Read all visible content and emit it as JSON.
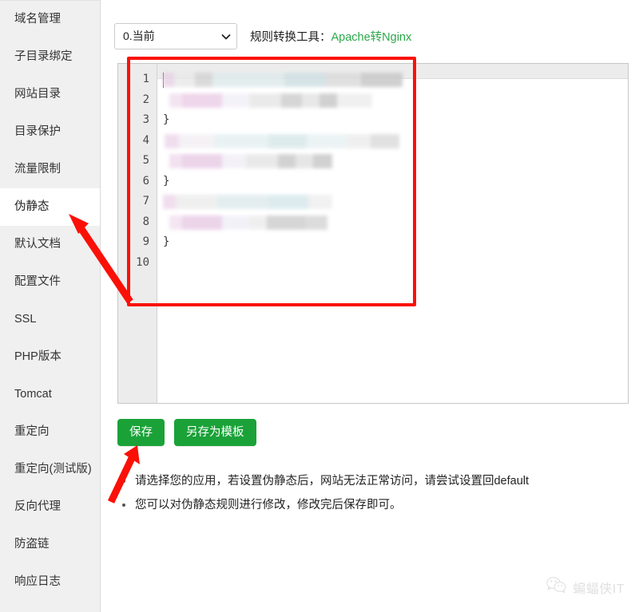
{
  "sidebar": {
    "items": [
      {
        "label": "域名管理",
        "active": false
      },
      {
        "label": "子目录绑定",
        "active": false
      },
      {
        "label": "网站目录",
        "active": false
      },
      {
        "label": "目录保护",
        "active": false
      },
      {
        "label": "流量限制",
        "active": false
      },
      {
        "label": "伪静态",
        "active": true
      },
      {
        "label": "默认文档",
        "active": false
      },
      {
        "label": "配置文件",
        "active": false
      },
      {
        "label": "SSL",
        "active": false
      },
      {
        "label": "PHP版本",
        "active": false
      },
      {
        "label": "Tomcat",
        "active": false
      },
      {
        "label": "重定向",
        "active": false
      },
      {
        "label": "重定向(测试版)",
        "active": false
      },
      {
        "label": "反向代理",
        "active": false
      },
      {
        "label": "防盗链",
        "active": false
      },
      {
        "label": "响应日志",
        "active": false
      }
    ]
  },
  "toolbar": {
    "select_value": "0.当前",
    "select_options": [
      "0.当前"
    ],
    "converter_label": "规则转换工具：",
    "converter_link": "Apache转Nginx",
    "link_color": "#2ba84a"
  },
  "editor": {
    "line_numbers": [
      "1",
      "2",
      "3",
      "4",
      "5",
      "6",
      "7",
      "8",
      "9",
      "10"
    ],
    "lines": [
      {
        "n": "1",
        "text": "",
        "redacted": true
      },
      {
        "n": "2",
        "text": "",
        "redacted": true
      },
      {
        "n": "3",
        "text": "}",
        "redacted": false
      },
      {
        "n": "4",
        "text": "",
        "redacted": true
      },
      {
        "n": "5",
        "text": "",
        "redacted": true
      },
      {
        "n": "6",
        "text": "}",
        "redacted": false
      },
      {
        "n": "7",
        "text": "",
        "redacted": true
      },
      {
        "n": "8",
        "text": "",
        "redacted": true
      },
      {
        "n": "9",
        "text": "}",
        "redacted": false
      },
      {
        "n": "10",
        "text": "",
        "redacted": false
      }
    ]
  },
  "buttons": {
    "save_label": "保存",
    "save_as_template_label": "另存为模板",
    "color": "#1aa238"
  },
  "notes": [
    "请选择您的应用，若设置伪静态后，网站无法正常访问，请尝试设置回default",
    "您可以对伪静态规则进行修改，修改完后保存即可。"
  ],
  "watermark": {
    "text": "蝙蝠侠IT",
    "icon": "wechat-icon"
  },
  "annotations": {
    "box_color": "#fb1008",
    "arrow_to_sidebar": "伪静态",
    "arrow_to_button": "保存"
  }
}
